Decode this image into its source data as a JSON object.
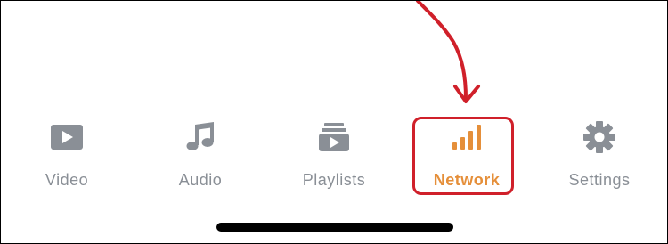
{
  "tab_bar": {
    "tabs": [
      {
        "label": "Video",
        "icon": "video-play-icon",
        "active": false
      },
      {
        "label": "Audio",
        "icon": "music-note-icon",
        "active": false
      },
      {
        "label": "Playlists",
        "icon": "playlist-icon",
        "active": false
      },
      {
        "label": "Network",
        "icon": "network-signal-icon",
        "active": true
      },
      {
        "label": "Settings",
        "icon": "gear-icon",
        "active": false
      }
    ]
  },
  "colors": {
    "inactive": "#8a8f96",
    "active": "#e58f3a",
    "annotation": "#d0202a"
  }
}
